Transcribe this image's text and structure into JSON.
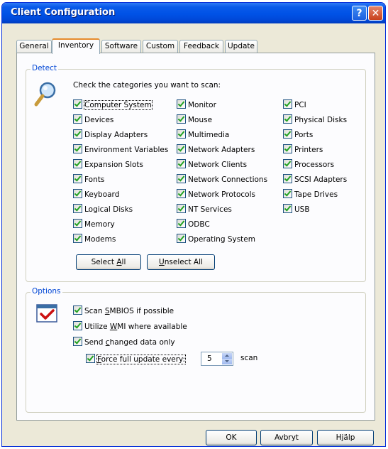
{
  "window": {
    "title": "Client Configuration",
    "help_glyph": "?",
    "close_glyph": "✕"
  },
  "tabs": [
    "General",
    "Inventory",
    "Software",
    "Custom",
    "Feedback",
    "Update"
  ],
  "active_tab": "Inventory",
  "detect": {
    "legend": "Detect",
    "instruction": "Check the categories you want to scan:",
    "col1": [
      "Computer System",
      "Devices",
      "Display Adapters",
      "Environment Variables",
      "Expansion Slots",
      "Fonts",
      "Keyboard",
      "Logical Disks",
      "Memory",
      "Modems"
    ],
    "col2": [
      "Monitor",
      "Mouse",
      "Multimedia",
      "Network Adapters",
      "Network Clients",
      "Network Connections",
      "Network Protocols",
      "NT Services",
      "ODBC",
      "Operating System"
    ],
    "col3": [
      "PCI",
      "Physical Disks",
      "Ports",
      "Printers",
      "Processors",
      "SCSI Adapters",
      "Tape Drives",
      "USB"
    ],
    "select_all": {
      "pre": "Select ",
      "u": "A",
      "post": "ll"
    },
    "unselect_all": {
      "pre": "",
      "u": "U",
      "post": "nselect All"
    }
  },
  "options": {
    "legend": "Options",
    "scan_smbios": {
      "pre": "Scan ",
      "u": "S",
      "post": "MBIOS if possible"
    },
    "utilize_wmi": {
      "pre": "Utilize ",
      "u": "W",
      "post": "MI where available"
    },
    "send_changed": {
      "pre": "Send ",
      "u": "c",
      "post": "hanged data only"
    },
    "force_full": {
      "pre": "",
      "u": "F",
      "post": "orce full update every:"
    },
    "scan_count": "5",
    "scan_unit": "scan"
  },
  "footer": {
    "ok": "OK",
    "cancel": "Avbryt",
    "help": "Hjälp"
  },
  "colors": {
    "title_bar": "#0054e3",
    "legend": "#0046d5",
    "check": "#21a121",
    "close": "#c8411d"
  }
}
